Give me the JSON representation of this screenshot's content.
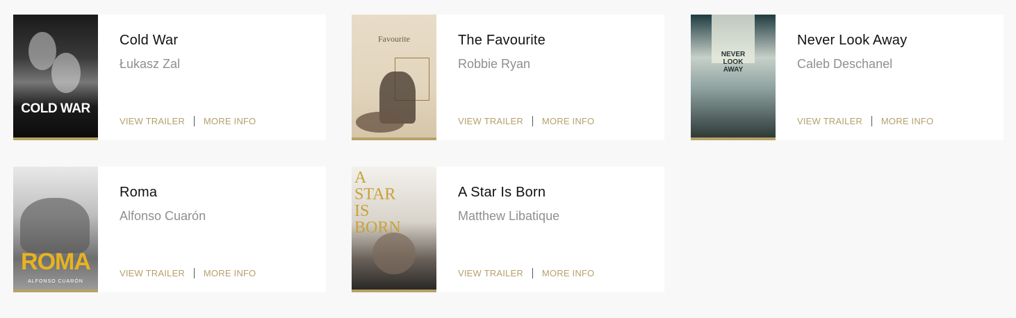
{
  "accent_color": "#b4a06c",
  "separator": "|",
  "cards": [
    {
      "title": "Cold War",
      "person": "Łukasz Zal",
      "poster_text": "COLD WAR",
      "view_trailer": "VIEW TRAILER",
      "more_info": "MORE INFO"
    },
    {
      "title": "The Favourite",
      "person": "Robbie Ryan",
      "poster_text": "Favourite",
      "view_trailer": "VIEW TRAILER",
      "more_info": "MORE INFO"
    },
    {
      "title": "Never Look Away",
      "person": "Caleb Deschanel",
      "poster_text": "NEVER LOOK AWAY",
      "view_trailer": "VIEW TRAILER",
      "more_info": "MORE INFO"
    },
    {
      "title": "Roma",
      "person": "Alfonso Cuarón",
      "poster_text": "ROMA",
      "poster_subtext": "ALFONSO CUARÓN",
      "view_trailer": "VIEW TRAILER",
      "more_info": "MORE INFO"
    },
    {
      "title": "A Star Is Born",
      "person": "Matthew Libatique",
      "poster_text": "A STAR IS BORN",
      "view_trailer": "VIEW TRAILER",
      "more_info": "MORE INFO"
    }
  ]
}
